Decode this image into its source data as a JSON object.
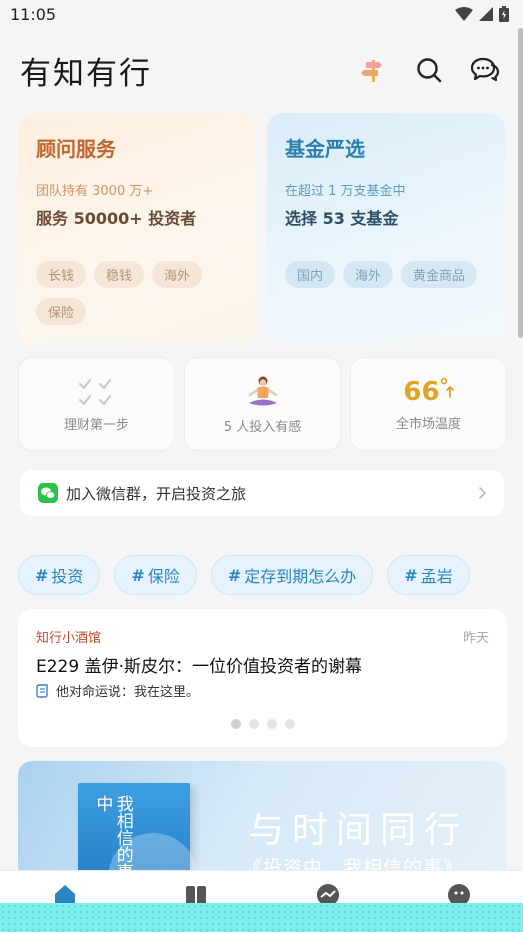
{
  "status_bar": {
    "time": "11:05"
  },
  "header": {
    "title": "有知有行"
  },
  "advisor_card": {
    "title": "顾问服务",
    "subtitle": "团队持有 3000 万+",
    "headline": "服务 50000+ 投资者",
    "tags": [
      "长钱",
      "稳钱",
      "海外",
      "保险"
    ]
  },
  "fund_card": {
    "title": "基金严选",
    "subtitle": "在超过 1 万支基金中",
    "headline": "选择 53 支基金",
    "tags": [
      "国内",
      "海外",
      "黄金商品"
    ]
  },
  "mini_cards": {
    "first_step": "理财第一步",
    "investors": "5 人投入有感",
    "temperature_value": "66",
    "temperature_label": "全市场温度"
  },
  "wechat": {
    "text": "加入微信群，开启投资之旅"
  },
  "topics": [
    "投资",
    "保险",
    "定存到期怎么办",
    "孟岩"
  ],
  "podcast": {
    "source": "知行小酒馆",
    "time": "昨天",
    "title": "E229 盖伊·斯皮尔：一位价值投资者的谢幕",
    "quote": "他对命运说：我在这里。",
    "pages": 4,
    "active_page": 1
  },
  "banner": {
    "headline": "与时间同行",
    "subtitle": "《投资中，我相信的事》",
    "book_title": "我相信的事投资中"
  },
  "colors": {
    "advisor_accent": "#c3652f",
    "fund_accent": "#2c7fb0",
    "topic_accent": "#2a86c2",
    "temperature": "#e0a323",
    "podcast_source": "#c34d2c"
  }
}
